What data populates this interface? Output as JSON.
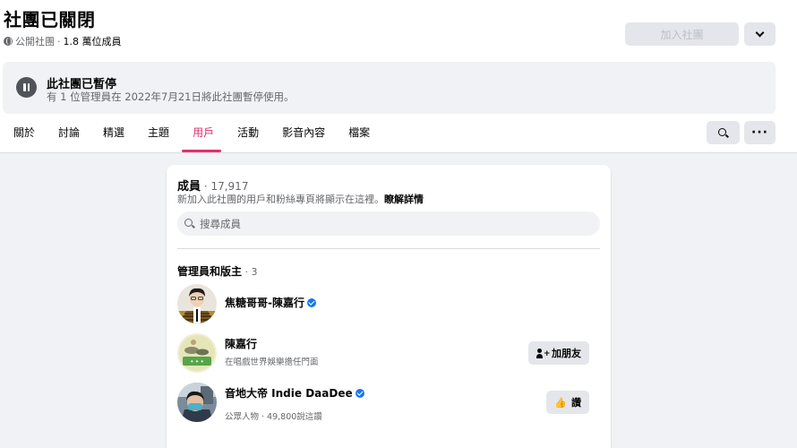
{
  "group": {
    "title": "社團已關閉",
    "privacy": "公開社團",
    "separator": " · ",
    "member_count": "1.8 萬位成員"
  },
  "header_actions": {
    "join_label": "加入社團"
  },
  "banner": {
    "title": "此社團已暫停",
    "subtitle": "有 1 位管理員在 2022年7月21日將此社團暫停使用。"
  },
  "tabs": [
    {
      "label": "關於",
      "active": false
    },
    {
      "label": "討論",
      "active": false
    },
    {
      "label": "精選",
      "active": false
    },
    {
      "label": "主題",
      "active": false
    },
    {
      "label": "用戶",
      "active": true
    },
    {
      "label": "活動",
      "active": false
    },
    {
      "label": "影音內容",
      "active": false
    },
    {
      "label": "檔案",
      "active": false
    }
  ],
  "tab_actions": {
    "more_label": "···"
  },
  "members": {
    "heading": "成員",
    "count": " · 17,917",
    "description": "新加入此社團的用戶和粉絲專頁將顯示在這裡。",
    "learn_more": "瞭解詳情",
    "search_placeholder": "搜尋成員",
    "admins_heading": "管理員和版主",
    "admins_count": " · 3",
    "people": [
      {
        "name": "焦糖哥哥-陳嘉行",
        "verified": true,
        "subtitle": "",
        "action": ""
      },
      {
        "name": "陳嘉行",
        "verified": false,
        "subtitle": "在唱戲世界娛樂擔任門面",
        "action": "加朋友"
      },
      {
        "name": "音地大帝 Indie DaaDee",
        "verified": true,
        "subtitle": "公眾人物 · 49,800說這讚",
        "action": "讚"
      }
    ]
  },
  "colors": {
    "accent": "#e1306c",
    "verified": "#1877f2",
    "secondary_text": "#65676b"
  }
}
